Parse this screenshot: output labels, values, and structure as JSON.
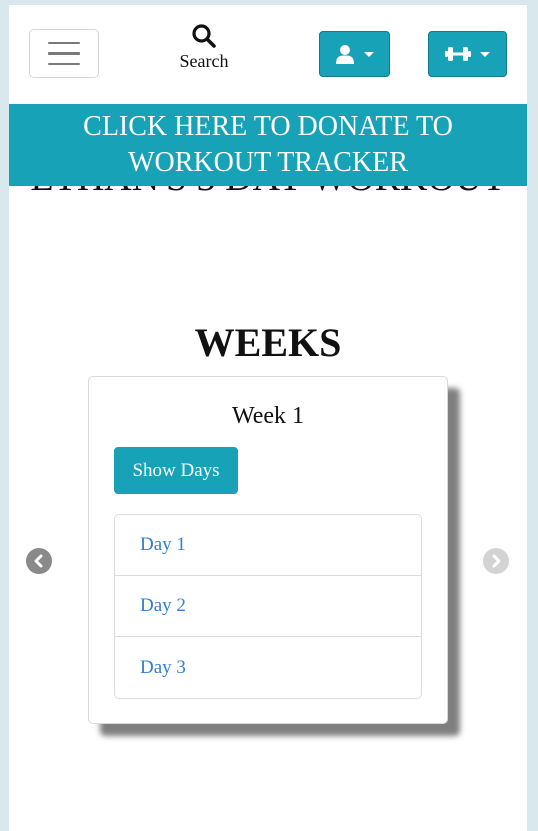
{
  "header": {
    "search_label": "Search"
  },
  "banner": {
    "donate_text": "CLICK HERE TO DONATE TO WORKOUT TRACKER"
  },
  "workout": {
    "title": "ETHAN'S 3 DAY WORKOUT",
    "weeks_heading": "WEEKS"
  },
  "week_card": {
    "title": "Week 1",
    "show_days_label": "Show Days",
    "days": [
      {
        "label": "Day 1"
      },
      {
        "label": "Day 2"
      },
      {
        "label": "Day 3"
      }
    ]
  },
  "colors": {
    "primary": "#17a2b8",
    "link": "#2f7fd4",
    "page_bg": "#d9e8ec"
  }
}
